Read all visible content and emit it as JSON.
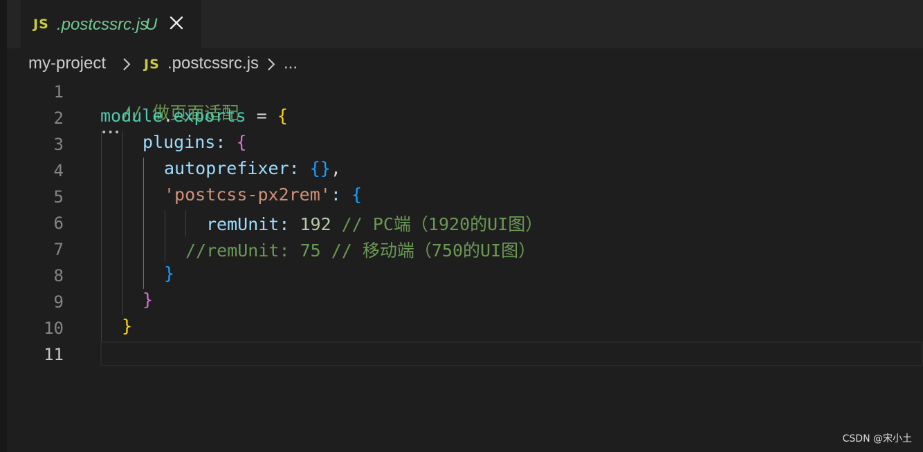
{
  "tab": {
    "icon": "JS",
    "filename": ".postcssrc.js",
    "status": "U",
    "close_icon": "close-icon"
  },
  "breadcrumb": {
    "folder": "my-project",
    "file_icon": "JS",
    "file": ".postcssrc.js",
    "more": "..."
  },
  "editor": {
    "line_numbers": [
      "1",
      "2",
      "3",
      "4",
      "5",
      "6",
      "7",
      "8",
      "9",
      "10",
      "11"
    ],
    "active_line": "11"
  },
  "code": {
    "l1": "// 做页面适配",
    "l2_module": "module",
    "l2_dot": ".",
    "l2_exports": "exports",
    "l2_eq": " = ",
    "l2_brace": "{",
    "l3_key": "plugins",
    "l3_colon": ": ",
    "l3_brace": "{",
    "l4_key": "autoprefixer",
    "l4_colon": ": ",
    "l4_braces": "{}",
    "l4_comma": ",",
    "l5_str": "'postcss-px2rem'",
    "l5_colon": ": ",
    "l5_brace": "{",
    "l6_key": "remUnit",
    "l6_colon": ": ",
    "l6_num": "192",
    "l6_comment": " // PC端（1920的UI图）",
    "l7_comment": "//remUnit: 75 // 移动端（750的UI图）",
    "l8_brace": "}",
    "l9_brace": "}",
    "l10_brace": "}"
  },
  "watermark": "CSDN @宋小土"
}
